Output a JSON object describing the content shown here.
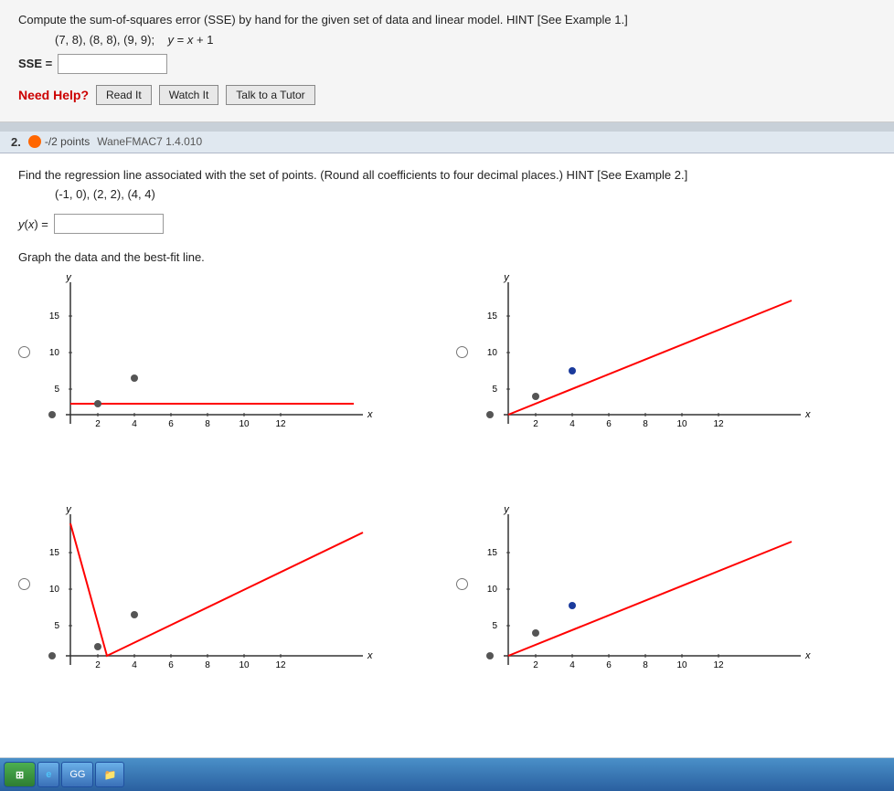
{
  "problem1": {
    "question": "Compute the sum-of-squares error (SSE) by hand for the given set of data and linear model. HINT [See Example 1.]",
    "data_points": "(7, 8), (8, 8), (9, 9);   y = x + 1",
    "sse_label": "SSE =",
    "sse_value": "",
    "need_help_label": "Need Help?",
    "btn_read": "Read It",
    "btn_watch": "Watch It",
    "btn_talk": "Talk to a Tutor"
  },
  "problem2": {
    "number": "2.",
    "points_text": "-/2 points",
    "course_code": "WaneFMAC7 1.4.010",
    "question": "Find the regression line associated with the set of points. (Round all coefficients to four decimal places.) HINT [See Example 2.]",
    "data_points": "(-1, 0), (2, 2), (4, 4)",
    "yx_label": "y(x) =",
    "yx_value": "",
    "graph_label": "Graph the data and the best-fit line.",
    "graphs": [
      {
        "id": "graph-a",
        "type": "flat_line",
        "selected": false
      },
      {
        "id": "graph-b",
        "type": "diagonal_line_up",
        "selected": false
      },
      {
        "id": "graph-c",
        "type": "v_shape",
        "selected": false
      },
      {
        "id": "graph-d",
        "type": "diagonal_line_up2",
        "selected": false
      }
    ]
  },
  "taskbar": {
    "start_label": "Start",
    "apps": [
      "e",
      "GG",
      ""
    ]
  }
}
